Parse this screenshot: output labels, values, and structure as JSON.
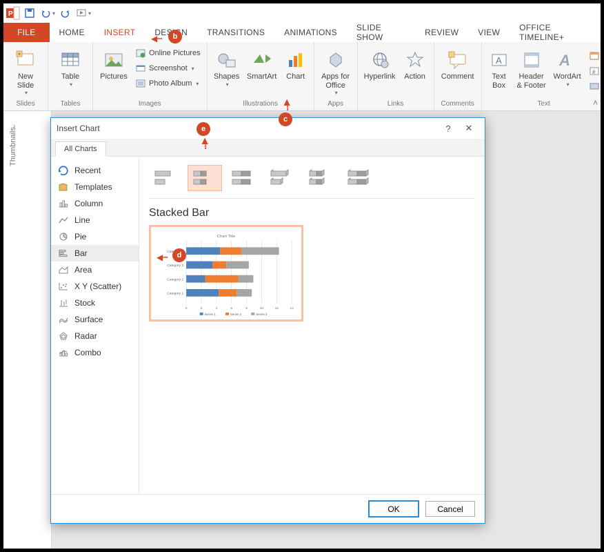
{
  "qat": {
    "save": "Save",
    "undo": "Undo",
    "redo": "Redo",
    "start": "Start From Beginning"
  },
  "tabs": {
    "file": "FILE",
    "home": "HOME",
    "insert": "INSERT",
    "design": "DESIGN",
    "transitions": "TRANSITIONS",
    "animations": "ANIMATIONS",
    "slideshow": "SLIDE SHOW",
    "review": "REVIEW",
    "view": "VIEW",
    "timeline": "OFFICE TIMELINE+"
  },
  "ribbon": {
    "slides": {
      "new_slide": "New\nSlide",
      "group": "Slides"
    },
    "tables": {
      "table": "Table",
      "group": "Tables"
    },
    "images": {
      "pictures": "Pictures",
      "online": "Online Pictures",
      "screenshot": "Screenshot",
      "album": "Photo Album",
      "group": "Images"
    },
    "illustrations": {
      "shapes": "Shapes",
      "smartart": "SmartArt",
      "chart": "Chart",
      "group": "Illustrations"
    },
    "apps": {
      "apps": "Apps for\nOffice",
      "group": "Apps"
    },
    "links": {
      "hyperlink": "Hyperlink",
      "action": "Action",
      "group": "Links"
    },
    "comments": {
      "comment": "Comment",
      "group": "Comments"
    },
    "text": {
      "textbox": "Text\nBox",
      "header": "Header\n& Footer",
      "wordart": "WordArt",
      "group": "Text"
    }
  },
  "thumbnails_label": "Thumbnails",
  "dialog": {
    "title": "Insert Chart",
    "help": "?",
    "close": "✕",
    "tab": "All Charts",
    "categories": [
      "Recent",
      "Templates",
      "Column",
      "Line",
      "Pie",
      "Bar",
      "Area",
      "X Y (Scatter)",
      "Stock",
      "Surface",
      "Radar",
      "Combo"
    ],
    "selected_category": "Bar",
    "subtypes": [
      "Clustered Bar",
      "Stacked Bar",
      "100% Stacked Bar",
      "3-D Clustered Bar",
      "3-D Stacked Bar",
      "3-D 100% Stacked Bar"
    ],
    "preview_name": "Stacked Bar",
    "ok": "OK",
    "cancel": "Cancel"
  },
  "callouts": {
    "b": "b",
    "c": "c",
    "d": "d",
    "e": "e"
  },
  "chart_data": {
    "type": "bar",
    "orientation": "horizontal",
    "stacked": true,
    "title": "Chart Title",
    "categories": [
      "Category 4",
      "Category 3",
      "Category 2",
      "Category 1"
    ],
    "series": [
      {
        "name": "Series 1",
        "color": "#4f81bd",
        "values": [
          4.5,
          3.5,
          2.5,
          4.3
        ]
      },
      {
        "name": "Series 2",
        "color": "#ed7d31",
        "values": [
          2.8,
          1.8,
          4.4,
          2.4
        ]
      },
      {
        "name": "Series 3",
        "color": "#a5a5a5",
        "values": [
          5.0,
          3.0,
          2.0,
          2.0
        ]
      }
    ],
    "xlabel": "",
    "ylabel": "",
    "xticks": [
      0,
      2,
      4,
      6,
      8,
      10,
      12,
      14
    ],
    "xlim": [
      0,
      14
    ]
  }
}
